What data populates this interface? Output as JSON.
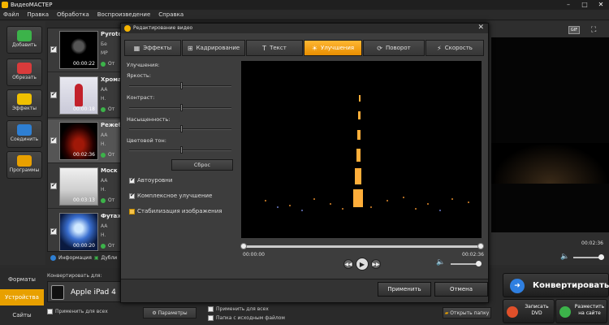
{
  "window": {
    "title": "ВидеоМАСТЕР"
  },
  "menu": [
    "Файл",
    "Правка",
    "Обработка",
    "Воспроизведение",
    "Справка"
  ],
  "toolbar": [
    {
      "label": "Добавить",
      "icon": "add-film-icon",
      "color": "#3cb34a"
    },
    {
      "label": "Обрезать",
      "icon": "cut-icon",
      "color": "#d93b3b"
    },
    {
      "label": "Эффекты",
      "icon": "effects-icon",
      "color": "#f0c000"
    },
    {
      "label": "Соединить",
      "icon": "join-icon",
      "color": "#2e7fd3"
    },
    {
      "label": "Программы",
      "icon": "programs-icon",
      "color": "#e8a000"
    }
  ],
  "files": [
    {
      "name": "Pyrote",
      "meta1": "Бе",
      "meta2": "MP",
      "status": "От",
      "duration": "00:00:22"
    },
    {
      "name": "Хрома",
      "meta1": "AA",
      "meta2": "H.",
      "status": "От",
      "duration": "00:00:18"
    },
    {
      "name": "Режеб",
      "meta1": "AA",
      "meta2": "H.",
      "status": "От",
      "duration": "00:02:36"
    },
    {
      "name": "Моск",
      "meta1": "AA",
      "meta2": "H.",
      "status": "От",
      "duration": "00:03:13"
    },
    {
      "name": "Футаж",
      "meta1": "AA",
      "meta2": "H.",
      "status": "От",
      "duration": "00:00:20"
    }
  ],
  "list_footer": {
    "info": "Информация",
    "dup": "Дубли"
  },
  "preview_right": {
    "gif": "GIF",
    "time": "00:02:36"
  },
  "bottom": {
    "side_tabs": [
      "Форматы",
      "Устройства",
      "Сайты"
    ],
    "convert_for": "Конвертировать для:",
    "device": "Apple iPad 4",
    "apply_all": "Применить для всех",
    "params": "Параметры",
    "apply_all2": "Применить для всех",
    "source_folder": "Папка с исходным файлом",
    "open_folder": "Открыть папку",
    "convert": "Конвертировать",
    "burn_dvd": "Записать DVD",
    "publish": "Разместить на сайте"
  },
  "dialog": {
    "title": "Редактирование видео",
    "tabs": [
      {
        "label": "Эффекты",
        "icon": "▦"
      },
      {
        "label": "Кадрирование",
        "icon": "⊞"
      },
      {
        "label": "Текст",
        "icon": "T"
      },
      {
        "label": "Улучшения",
        "icon": "☀"
      },
      {
        "label": "Поворот",
        "icon": "⟳"
      },
      {
        "label": "Скорость",
        "icon": "⚡"
      }
    ],
    "active_tab": 3,
    "section": "Улучшения:",
    "brightness": "Яркость:",
    "contrast": "Контраст:",
    "saturation": "Насыщенность:",
    "hue": "Цветовой тон:",
    "levels": {
      "brightness": 0.5,
      "contrast": 0.5,
      "saturation": 0.5,
      "hue": 0.5
    },
    "reset": "Сброс",
    "auto_levels": "Автоуровни",
    "complex": "Комплексное улучшение",
    "stabilize": "Стабилизация изображения",
    "time_start": "00:00:00",
    "time_end": "00:02:36",
    "apply": "Применить",
    "cancel": "Отмена"
  }
}
